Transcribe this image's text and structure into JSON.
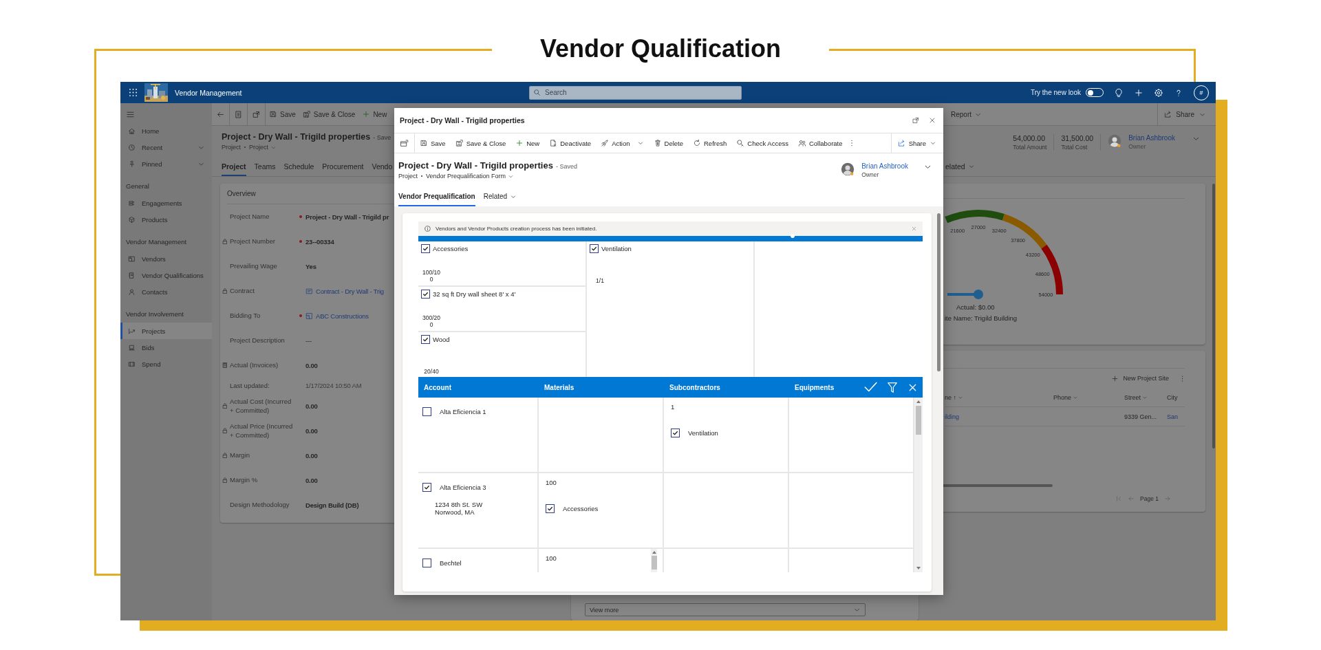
{
  "page_title": "Vendor Qualification",
  "top_bar": {
    "app_name": "Vendor Management",
    "search": {
      "placeholder": "Search"
    },
    "new_look": {
      "label": "Try the new look",
      "on": false
    },
    "avatar": "#"
  },
  "nav": {
    "items": [
      {
        "label": "Home",
        "kind": "link",
        "selected": false
      },
      {
        "label": "Recent",
        "kind": "menu",
        "selected": false
      },
      {
        "label": "Pinned",
        "kind": "menu",
        "selected": false
      }
    ],
    "groups": [
      {
        "title": "General",
        "items": [
          {
            "label": "Engagements",
            "selected": false
          },
          {
            "label": "Products",
            "selected": false
          }
        ]
      },
      {
        "title": "Vendor Management",
        "items": [
          {
            "label": "Vendors",
            "selected": false
          },
          {
            "label": "Vendor Qualifications",
            "selected": false
          },
          {
            "label": "Contacts",
            "selected": false
          }
        ]
      },
      {
        "title": "Vendor Involvement",
        "items": [
          {
            "label": "Projects",
            "selected": true
          },
          {
            "label": "Bids",
            "selected": false
          },
          {
            "label": "Spend",
            "selected": false
          }
        ]
      }
    ]
  },
  "form": {
    "commands": [
      {
        "label": "Save"
      },
      {
        "label": "Save & Close"
      },
      {
        "label": "New"
      }
    ],
    "right_commands": [
      {
        "label": "Report"
      },
      {
        "label": "Share"
      }
    ],
    "title": "Project - Dry Wall - Trigild properties",
    "status": "- Save",
    "breadcrumb": [
      "Project",
      "Project"
    ],
    "summary": [
      {
        "value": "54,000.00",
        "label": "Total Amount"
      },
      {
        "value": "31,500.00",
        "label": "Total Cost"
      }
    ],
    "owner": {
      "name": "Brian Ashbrook",
      "role": "Owner"
    },
    "tabs": [
      {
        "label": "Project",
        "selected": true
      },
      {
        "label": "Teams",
        "selected": false
      },
      {
        "label": "Schedule",
        "selected": false
      },
      {
        "label": "Procurement",
        "selected": false
      },
      {
        "label": "Vendo",
        "selected": false
      }
    ],
    "related_tab": "elated",
    "overview": {
      "title": "Overview",
      "fields": [
        {
          "label": "Project Name",
          "required": true,
          "locked": false,
          "rollup": false,
          "kind": "bold",
          "value": "Project - Dry Wall - Trigild pr"
        },
        {
          "label": "Project Number",
          "required": true,
          "locked": true,
          "rollup": false,
          "kind": "bold",
          "value": "23--00334"
        },
        {
          "label": "Prevailing Wage",
          "required": false,
          "locked": false,
          "rollup": false,
          "kind": "bold",
          "value": "Yes"
        },
        {
          "label": "Contract",
          "required": false,
          "locked": true,
          "rollup": false,
          "kind": "link",
          "value": "Contract - Dry Wall - Trig"
        },
        {
          "label": "Bidding To",
          "required": true,
          "locked": false,
          "rollup": false,
          "kind": "link",
          "value": "ABC Constructions"
        },
        {
          "label": "Project Description",
          "required": false,
          "locked": false,
          "rollup": false,
          "kind": "text",
          "value": "---"
        },
        {
          "label": "Actual (Invoices)",
          "required": false,
          "locked": false,
          "rollup": true,
          "kind": "bold",
          "value": "0.00"
        },
        {
          "label": "Last updated:",
          "required": false,
          "locked": false,
          "rollup": false,
          "kind": "muted",
          "value": "1/17/2024 10:50 AM"
        },
        {
          "label": "Actual Cost (Incurred + Committed)",
          "required": false,
          "locked": true,
          "rollup": false,
          "kind": "bold",
          "value": "0.00"
        },
        {
          "label": "Actual Price (Incurred + Committed)",
          "required": false,
          "locked": true,
          "rollup": false,
          "kind": "bold",
          "value": "0.00"
        },
        {
          "label": "Margin",
          "required": false,
          "locked": true,
          "rollup": false,
          "kind": "bold",
          "value": "0.00"
        },
        {
          "label": "Margin %",
          "required": false,
          "locked": true,
          "rollup": false,
          "kind": "bold",
          "value": "0.00"
        },
        {
          "label": "Design Methodology",
          "required": false,
          "locked": false,
          "rollup": false,
          "kind": "bold",
          "value": "Design Build (DB)"
        }
      ]
    },
    "view_more": "View more",
    "gauge": {
      "ticks": [
        "21600",
        "27000",
        "32400",
        "37800",
        "43200",
        "48600",
        "54000"
      ],
      "actual": "Actual: $0.00",
      "site": "ite Name: Trigild Building"
    },
    "sites": {
      "new_button": "New Project Site",
      "columns": [
        {
          "label": "ne ↑",
          "menu": true
        },
        {
          "label": "Phone",
          "menu": true
        },
        {
          "label": "Street",
          "menu": true
        },
        {
          "label": "City",
          "menu": false
        }
      ],
      "rows": [
        {
          "name": "ilding",
          "street": "9339 Gen...",
          "city": "San"
        }
      ],
      "page": "Page 1"
    }
  },
  "dialog": {
    "title": "Project - Dry Wall - Trigild properties",
    "commands": [
      {
        "label": "Save",
        "kind": "button"
      },
      {
        "label": "Save & Close",
        "kind": "button"
      },
      {
        "label": "New",
        "kind": "button"
      },
      {
        "label": "Deactivate",
        "kind": "button"
      },
      {
        "label": "Action",
        "kind": "dropdown"
      },
      {
        "label": "Delete",
        "kind": "button"
      },
      {
        "label": "Refresh",
        "kind": "button"
      },
      {
        "label": "Check Access",
        "kind": "button"
      },
      {
        "label": "Collaborate",
        "kind": "button"
      }
    ],
    "share": "Share",
    "record": {
      "title": "Project - Dry Wall - Trigild properties",
      "status": "- Saved",
      "breadcrumb": [
        "Project",
        "Vendor Prequalification Form"
      ],
      "owner": {
        "name": "Brian Ashbrook",
        "role": "Owner"
      }
    },
    "tabs": [
      {
        "label": "Vendor Prequalification",
        "selected": true,
        "kind": "tab"
      },
      {
        "label": "Related",
        "selected": false,
        "kind": "dropdown"
      }
    ],
    "notification": "Vendors and Vendor Products creation process has been initiated.",
    "product_columns": [
      [
        {
          "label": "Accessories",
          "checked": true,
          "ratio": "100/100"
        },
        {
          "label": "32 sq ft Dry wall sheet 8' x 4'",
          "checked": true,
          "ratio": "300/200"
        },
        {
          "label": "Wood",
          "checked": true,
          "ratio": "20/40"
        }
      ],
      [
        {
          "label": "Ventilation",
          "checked": true,
          "ratio": "1/1"
        }
      ]
    ],
    "grid": {
      "columns": [
        "Account",
        "Materials",
        "Subcontractors",
        "Equipments"
      ],
      "rows": [
        {
          "account": {
            "name": "Alta Eficiencia 1",
            "checked": false
          },
          "subcontractors": {
            "count": "1",
            "scrollable": false,
            "items": [
              {
                "label": "Ventilation",
                "checked": true
              }
            ]
          }
        },
        {
          "account": {
            "name": "Alta Eficiencia 3",
            "checked": true,
            "address": [
              "1234 8th St. SW",
              "Norwood, MA"
            ]
          },
          "materials": {
            "count": "100",
            "scrollable": false,
            "items": [
              {
                "label": "Accessories",
                "checked": true
              }
            ]
          }
        },
        {
          "account": {
            "name": "Bechtel",
            "checked": false
          },
          "materials": {
            "count": "100",
            "scrollable": true
          }
        }
      ]
    }
  }
}
